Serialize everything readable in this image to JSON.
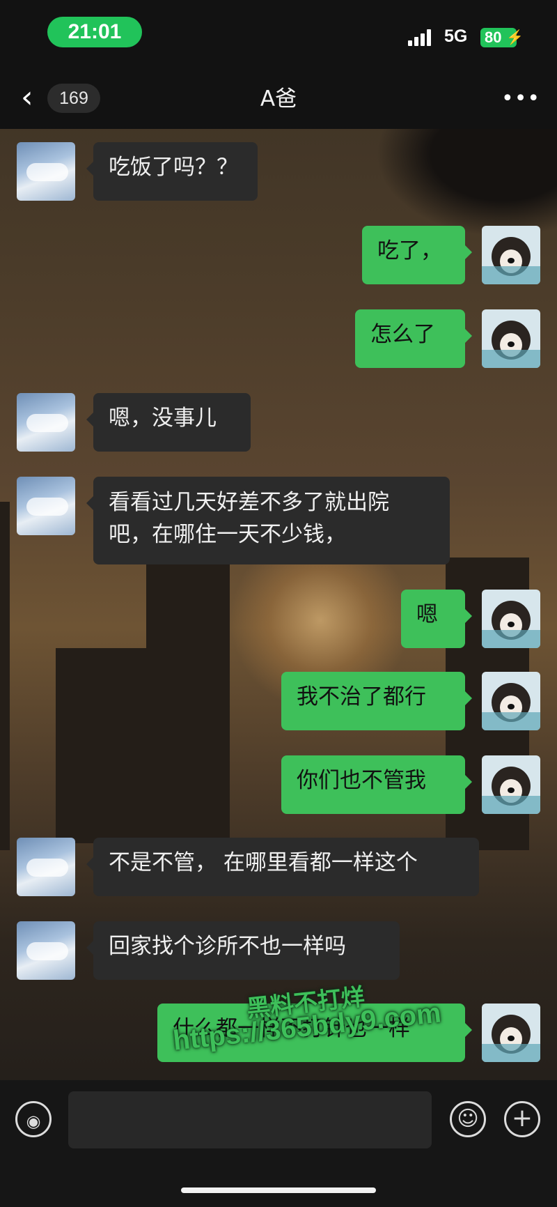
{
  "status_bar": {
    "time": "21:01",
    "network": "5G",
    "battery": "80",
    "battery_icon": "bolt-icon"
  },
  "header": {
    "back_icon": "chevron-left-icon",
    "unread_count": "169",
    "title": "A爸",
    "more_icon": "more-icon"
  },
  "messages": [
    {
      "side": "in",
      "avatar": "sky-avatar",
      "text": "吃饭了吗？？"
    },
    {
      "side": "out",
      "avatar": "dog-avatar",
      "text": "吃了，"
    },
    {
      "side": "out",
      "avatar": "dog-avatar",
      "text": "怎么了"
    },
    {
      "side": "in",
      "avatar": "sky-avatar",
      "text": "嗯，没事儿"
    },
    {
      "side": "in",
      "avatar": "sky-avatar",
      "text": "看看过几天好差不多了就出院\n吧，在哪住一天不少钱，"
    },
    {
      "side": "out",
      "avatar": "dog-avatar",
      "text": "嗯"
    },
    {
      "side": "out",
      "avatar": "dog-avatar",
      "text": "我不治了都行"
    },
    {
      "side": "out",
      "avatar": "dog-avatar",
      "text": "你们也不管我"
    },
    {
      "side": "in",
      "avatar": "sky-avatar",
      "text": "不是不管， 在哪里看都一样这个"
    },
    {
      "side": "in",
      "avatar": "sky-avatar",
      "text": "回家找个诊所不也一样吗"
    },
    {
      "side": "out",
      "avatar": "dog-avatar",
      "text": "什么都一样不打针也一样"
    }
  ],
  "watermark": {
    "line1": "黑料不打烊",
    "line2": "https://365bdy9.com"
  },
  "input_bar": {
    "voice_icon": "voice-icon",
    "emoji_icon": "emoji-icon",
    "plus_icon": "plus-icon",
    "input_value": ""
  },
  "colors": {
    "outgoing_bubble": "#3ec05a",
    "incoming_bubble": "#2b2b2b",
    "status_green": "#21c35a"
  }
}
